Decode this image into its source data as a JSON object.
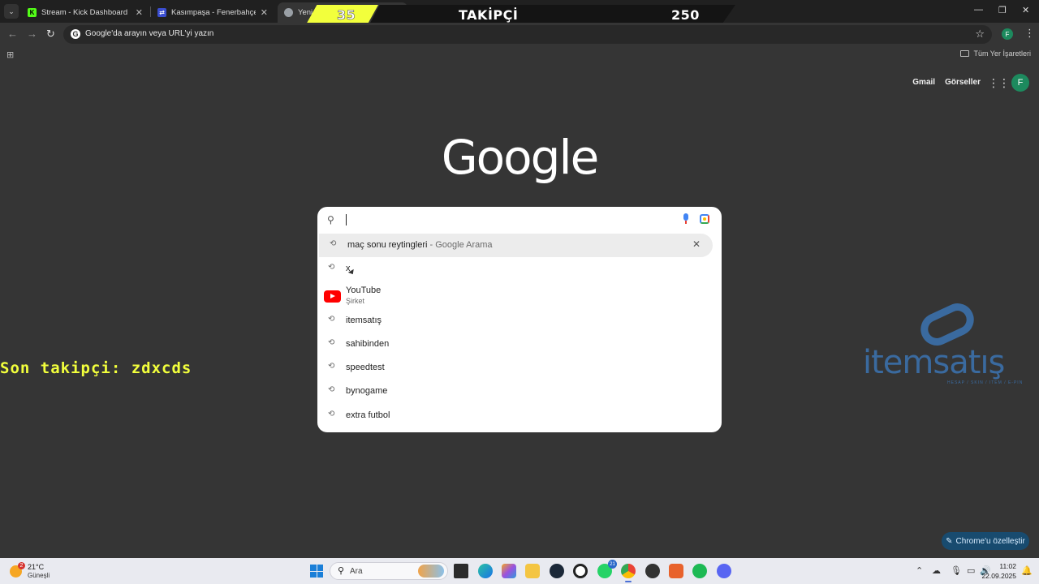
{
  "tabs": [
    {
      "title": "Stream - Kick Dashboard",
      "favicon": "kick-icon",
      "color": "#53fc18"
    },
    {
      "title": "Kasımpaşa - Fenerbahçe canlı skor",
      "favicon": "match-icon",
      "color": "#3b4ed1"
    },
    {
      "title": "Yeni Sekme",
      "favicon": "chrome-icon",
      "active": true
    }
  ],
  "overlay": {
    "follower_count": "35",
    "goal_title": "TAKİPÇİ HEDEF",
    "goal_value": "250",
    "last_follower": "Son takipçi: zdxcds",
    "brand_name": "itemsatış",
    "brand_tagline": "HESAP / SKIN / ITEM / E-PIN",
    "accent": "#f2ff3c"
  },
  "omnibox": {
    "placeholder": "Google'da arayın veya URL'yi yazın"
  },
  "bookmarks": {
    "all_bookmarks": "Tüm Yer İşaretleri"
  },
  "ntp": {
    "gmail": "Gmail",
    "images": "Görseller",
    "profile_initial": "F",
    "logo": "Google",
    "customize": "Chrome'u özelleştir"
  },
  "suggestions": [
    {
      "type": "history",
      "text": "maç sonu reytingleri",
      "sub": " - Google Arama",
      "highlighted": true
    },
    {
      "type": "history",
      "text": "x"
    },
    {
      "type": "entity",
      "text": "YouTube",
      "sub": "Şirket"
    },
    {
      "type": "history",
      "text": "itemsatış"
    },
    {
      "type": "history",
      "text": "sahibinden"
    },
    {
      "type": "history",
      "text": "speedtest"
    },
    {
      "type": "history",
      "text": "bynogame"
    },
    {
      "type": "history",
      "text": "extra futbol"
    }
  ],
  "taskbar": {
    "temperature": "21°C",
    "weather": "Güneşli",
    "weather_badge": "2",
    "search_placeholder": "Ara",
    "whatsapp_badge": "21",
    "time": "11:02",
    "date": "22.09.2025"
  }
}
